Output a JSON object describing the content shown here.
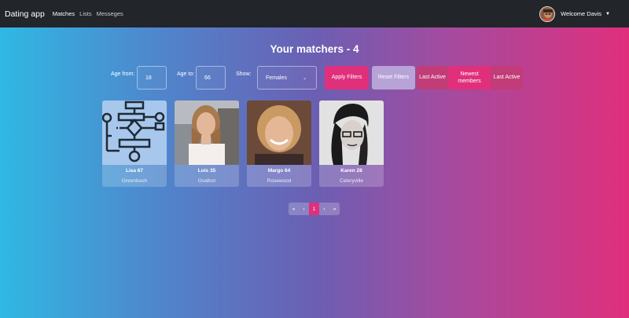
{
  "nav": {
    "brand": "Dating app",
    "links": [
      "Matches",
      "Lists",
      "Messeges"
    ],
    "welcome": "Welcome Davis"
  },
  "title": "Your matchers - 4",
  "filters": {
    "age_from_label": "Age from:",
    "age_from_value": "18",
    "age_to_label": "Age to:",
    "age_to_value": "66",
    "show_label": "Show:",
    "show_value": "Females",
    "apply": "Apply Filters",
    "reset": "Reset Filters",
    "last_active_1": "Last Active",
    "newest": "Newest members",
    "last_active_2": "Last Active"
  },
  "members": [
    {
      "name": "Lisa 67",
      "city": "Greenbush"
    },
    {
      "name": "Lois 35",
      "city": "Ovalton"
    },
    {
      "name": "Margo 64",
      "city": "Rosewood"
    },
    {
      "name": "Karen 28",
      "city": "Celeryville"
    }
  ],
  "pagination": {
    "first": "«",
    "prev": "‹",
    "current": "1",
    "next": "›",
    "last": "»"
  },
  "colors": {
    "navbar": "#22252a",
    "accent": "#e0307c",
    "reset": "#b7a3d6",
    "sort_dark": "#c23c78",
    "sort_active": "#e0307c"
  }
}
